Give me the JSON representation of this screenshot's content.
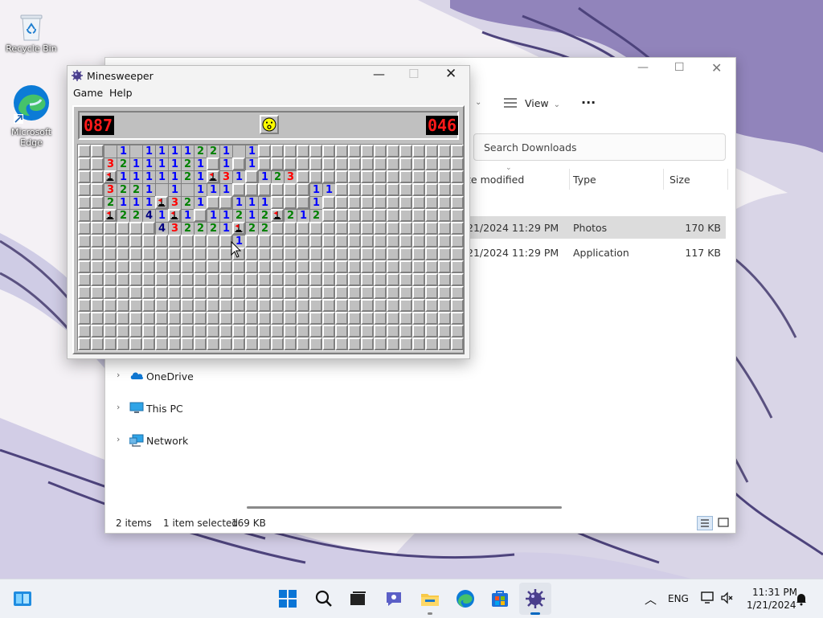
{
  "desktop": {
    "icons": [
      {
        "label": "Recycle Bin"
      },
      {
        "label": "Microsoft Edge"
      }
    ]
  },
  "explorer": {
    "toolbar": {
      "view_label": "View",
      "more_label": "···"
    },
    "search_placeholder": "Search Downloads",
    "columns": {
      "date_partial": "te modified",
      "type": "Type",
      "size": "Size"
    },
    "rows": [
      {
        "date": "21/2024 11:29 PM",
        "type": "Photos",
        "size": "170 KB",
        "selected": true
      },
      {
        "date": "21/2024 11:29 PM",
        "type": "Application",
        "size": "117 KB",
        "selected": false
      }
    ],
    "nav": [
      {
        "label": "OneDrive"
      },
      {
        "label": "This PC"
      },
      {
        "label": "Network"
      }
    ],
    "status": {
      "items": "2 items",
      "selected": "1 item selected",
      "size": "169 KB"
    }
  },
  "minesweeper": {
    "title": "Minesweeper",
    "menu": [
      "Game",
      "Help"
    ],
    "mines_counter": "087",
    "timer": "046",
    "board": [
      "..-1-1111221-1........",
      "..32111121.1.1........",
      "..f1111121f31.123.....",
      "..3221-1-111......11..",
      "..2111f321..111...1...",
      "..f2241f1.11212f212...",
      "......432221f22.......",
      "............1........."
    ]
  },
  "taskbar": {
    "lang": "ENG",
    "time": "11:31 PM",
    "date": "1/21/2024"
  },
  "colors": {
    "ms_gray": "#c0c0c0",
    "lcd_red": "#ff1a1a",
    "selection": "#dcdcdc",
    "accent_blue": "#0067c0"
  }
}
